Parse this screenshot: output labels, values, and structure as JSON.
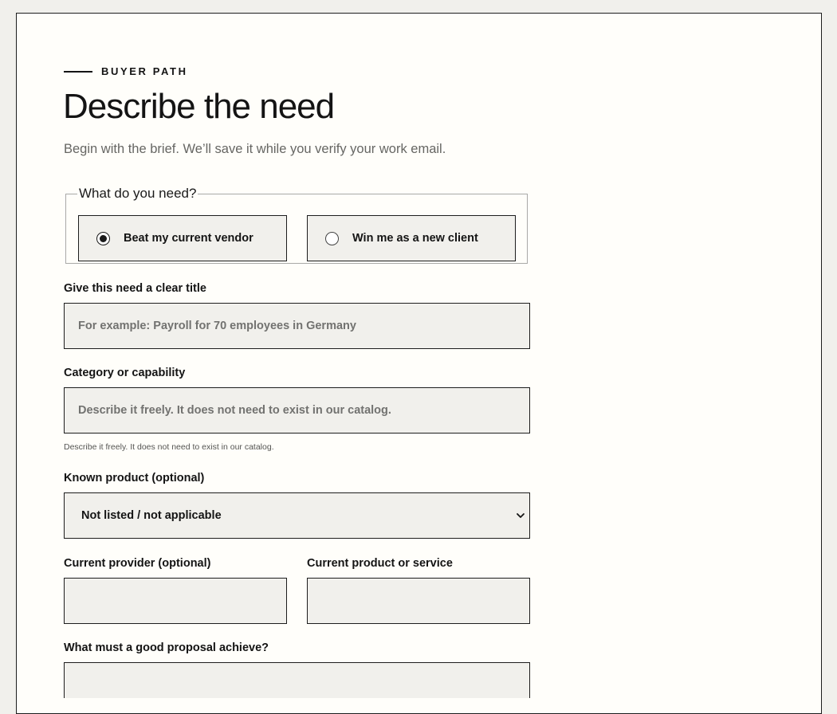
{
  "eyebrow": "BUYER PATH",
  "title": "Describe the need",
  "subtitle": "Begin with the brief. We’ll save it while you verify your work email.",
  "need_type": {
    "legend": "What do you need?",
    "options": [
      {
        "label": "Beat my current vendor",
        "checked": true
      },
      {
        "label": "Win me as a new client",
        "checked": false
      }
    ]
  },
  "fields": {
    "title": {
      "label": "Give this need a clear title",
      "placeholder": "For example: Payroll for 70 employees in Germany",
      "value": ""
    },
    "category": {
      "label": "Category or capability",
      "placeholder": "Describe it freely. It does not need to exist in our catalog.",
      "value": "",
      "hint": "Describe it freely. It does not need to exist in our catalog."
    },
    "known_product": {
      "label": "Known product (optional)",
      "selected": "Not listed / not applicable"
    },
    "current_provider": {
      "label": "Current provider (optional)",
      "value": ""
    },
    "current_product": {
      "label": "Current product or service",
      "value": ""
    },
    "proposal_goal": {
      "label": "What must a good proposal achieve?",
      "value": ""
    }
  },
  "icons": {
    "select_arrow": "chevron-down-icon"
  }
}
